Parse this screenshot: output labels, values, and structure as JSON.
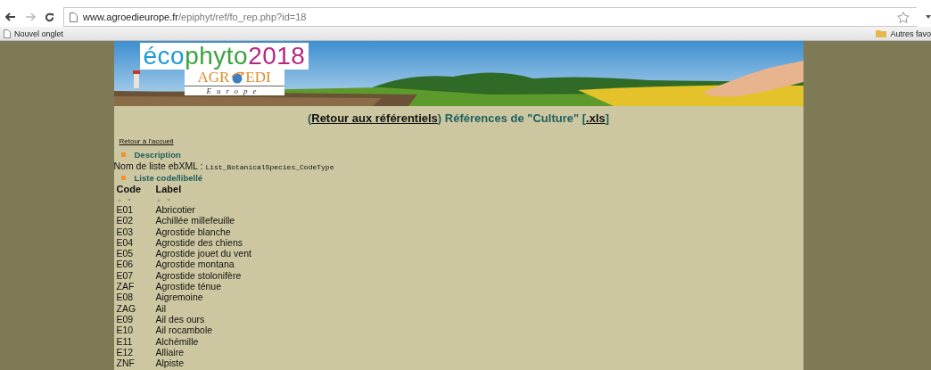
{
  "browser": {
    "url_host": "www.agroedieurope.fr",
    "url_path": "/epiphyt/ref/fo_rep.php?id=18",
    "bookmarks": [
      "Nouvel onglet"
    ],
    "other_bookmarks": "Autres favo"
  },
  "banner": {
    "kind": "picture",
    "ecophyto": [
      {
        "text": "éco",
        "color": "#1d9ad6"
      },
      {
        "text": "phyto",
        "color": "#3aa33c"
      },
      {
        "text": "2018",
        "color": "#b5287f"
      }
    ],
    "agroedi": {
      "left": "AGR",
      "right": "EDI",
      "sub": "Europe"
    }
  },
  "header": {
    "before": "(",
    "link": "Retour aux référentiels",
    "middle": ") Références de \"Culture\" [",
    "file_link": ".xls",
    "after": "]"
  },
  "home_link": "Retour à l'accueil",
  "description": {
    "title": "Description",
    "label": "Nom de liste ebXML : ",
    "value": "List_BotanicalSpecies_CodeType"
  },
  "list": {
    "title": "Liste code/libellé",
    "columns": [
      "Code",
      "Label"
    ],
    "rows": [
      {
        "code": "E01",
        "label": "Abricotier"
      },
      {
        "code": "E02",
        "label": "Achillée millefeuille"
      },
      {
        "code": "E03",
        "label": "Agrostide blanche"
      },
      {
        "code": "E04",
        "label": "Agrostide des chiens"
      },
      {
        "code": "E05",
        "label": "Agrostide jouet du vent"
      },
      {
        "code": "E06",
        "label": "Agrostide montana"
      },
      {
        "code": "E07",
        "label": "Agrostide stolonifère"
      },
      {
        "code": "ZAF",
        "label": "Agrostide ténue"
      },
      {
        "code": "E08",
        "label": "Aigremoine"
      },
      {
        "code": "ZAG",
        "label": "Ail"
      },
      {
        "code": "E09",
        "label": "Ail des ours"
      },
      {
        "code": "E10",
        "label": "Ail rocambole"
      },
      {
        "code": "E11",
        "label": "Alchémille"
      },
      {
        "code": "E12",
        "label": "Alliaire"
      },
      {
        "code": "ZNF",
        "label": "Alpiste"
      }
    ]
  }
}
